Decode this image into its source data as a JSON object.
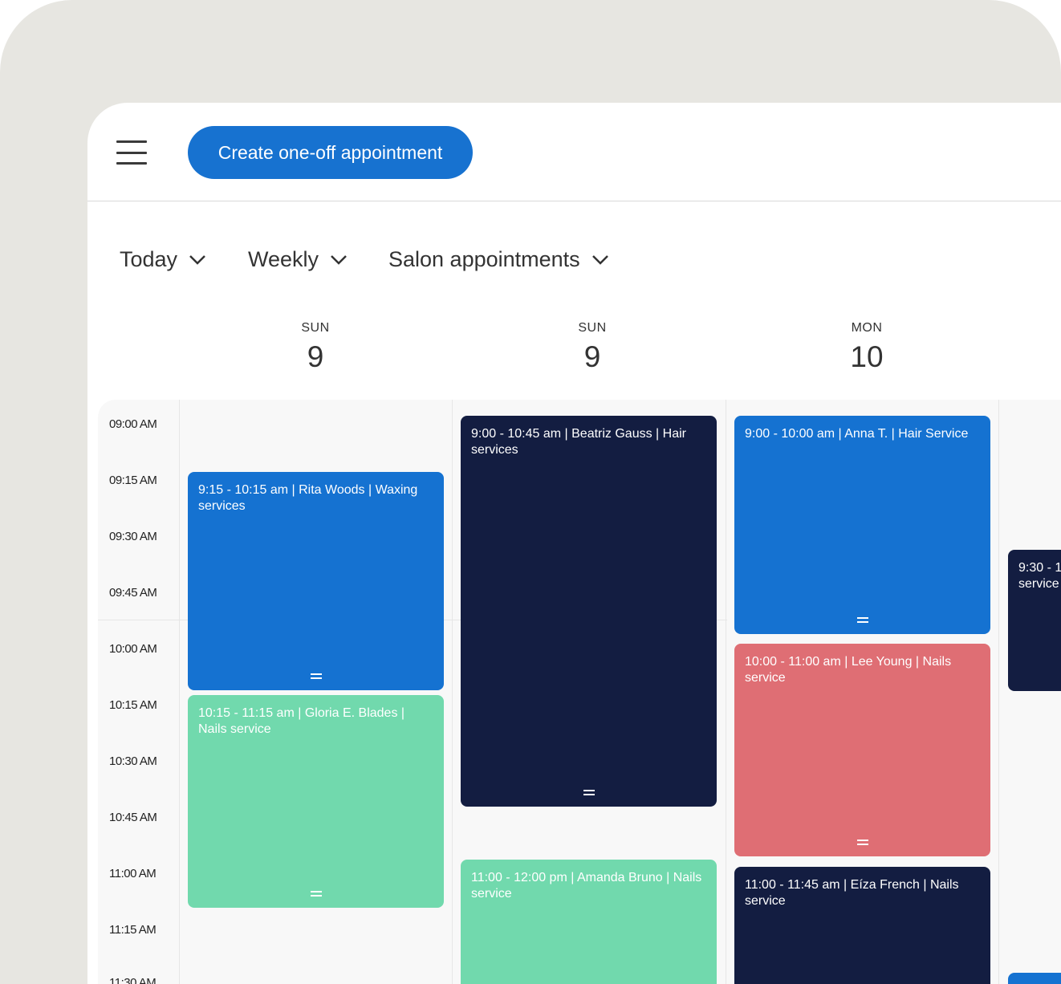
{
  "toolbar": {
    "menu_icon": "hamburger-menu-icon",
    "create_label": "Create one-off appointment"
  },
  "filters": [
    {
      "label": "Today",
      "icon": "chevron-down-icon"
    },
    {
      "label": "Weekly",
      "icon": "chevron-down-icon"
    },
    {
      "label": "Salon appointments",
      "icon": "chevron-down-icon"
    }
  ],
  "days": [
    {
      "dow": "SUN",
      "num": "9"
    },
    {
      "dow": "SUN",
      "num": "9"
    },
    {
      "dow": "MON",
      "num": "10"
    }
  ],
  "times": [
    "09:00 AM",
    "09:15 AM",
    "09:30 AM",
    "09:45 AM",
    "10:00 AM",
    "10:15 AM",
    "10:30 AM",
    "10:45 AM",
    "11:00 AM",
    "11:15 AM",
    "11:30 AM"
  ],
  "appointments": [
    {
      "text": "9:15 - 10:15 am | Rita Woods | Waxing services",
      "color": "#1572d1"
    },
    {
      "text": "10:15 - 11:15 am | Gloria E. Blades | Nails service",
      "color": "#71d9ad"
    },
    {
      "text": "9:00 - 10:45 am | Beatriz Gauss | Hair services",
      "color": "#131d41"
    },
    {
      "text": "11:00 - 12:00 pm | Amanda Bruno | Nails service",
      "color": "#71d9ad"
    },
    {
      "text": "9:00 - 10:00 am | Anna T. | Hair Service",
      "color": "#1572d1"
    },
    {
      "text": "10:00 - 11:00 am | Lee Young | Nails service",
      "color": "#df6e74"
    },
    {
      "text": "11:00 - 11:45 am | Eíza French | Nails service",
      "color": "#131d41"
    },
    {
      "text": "9:30 - 1",
      "text2": "service",
      "color": "#131d41"
    }
  ],
  "colors": {
    "primary": "#1772d0",
    "navy": "#131d41",
    "green": "#71d9ad",
    "red": "#df6e74",
    "device": "#e7e6e1"
  }
}
